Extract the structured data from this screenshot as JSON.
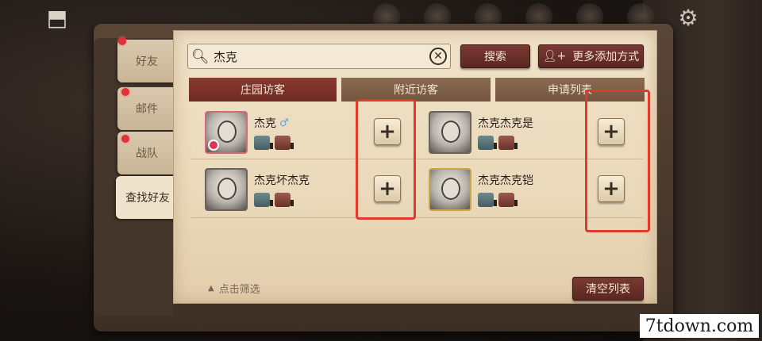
{
  "side_tabs": [
    {
      "label": "好友",
      "dot": true
    },
    {
      "label": "邮件",
      "dot": true
    },
    {
      "label": "战队",
      "dot": true
    },
    {
      "label": "查找好友",
      "dot": false
    }
  ],
  "search": {
    "value": "杰克",
    "search_button": "搜索",
    "more_button": "更多添加方式"
  },
  "visitor_tabs": [
    {
      "label": "庄园访客",
      "active": true
    },
    {
      "label": "附近访客",
      "active": false
    },
    {
      "label": "申请列表",
      "active": false
    }
  ],
  "players": [
    {
      "name": "杰克",
      "gender": "♂"
    },
    {
      "name": "杰克杰克是",
      "gender": ""
    },
    {
      "name": "杰克坏杰克",
      "gender": ""
    },
    {
      "name": "杰克杰克铠",
      "gender": ""
    }
  ],
  "add_icon": "plus-icon",
  "footer": {
    "filter_label": "点击筛选",
    "clear_button": "清空列表"
  },
  "watermark": "7tdown.com",
  "colors": {
    "accent": "#7a3a32",
    "highlight": "#e03a2a",
    "paper": "#efe2c7"
  }
}
